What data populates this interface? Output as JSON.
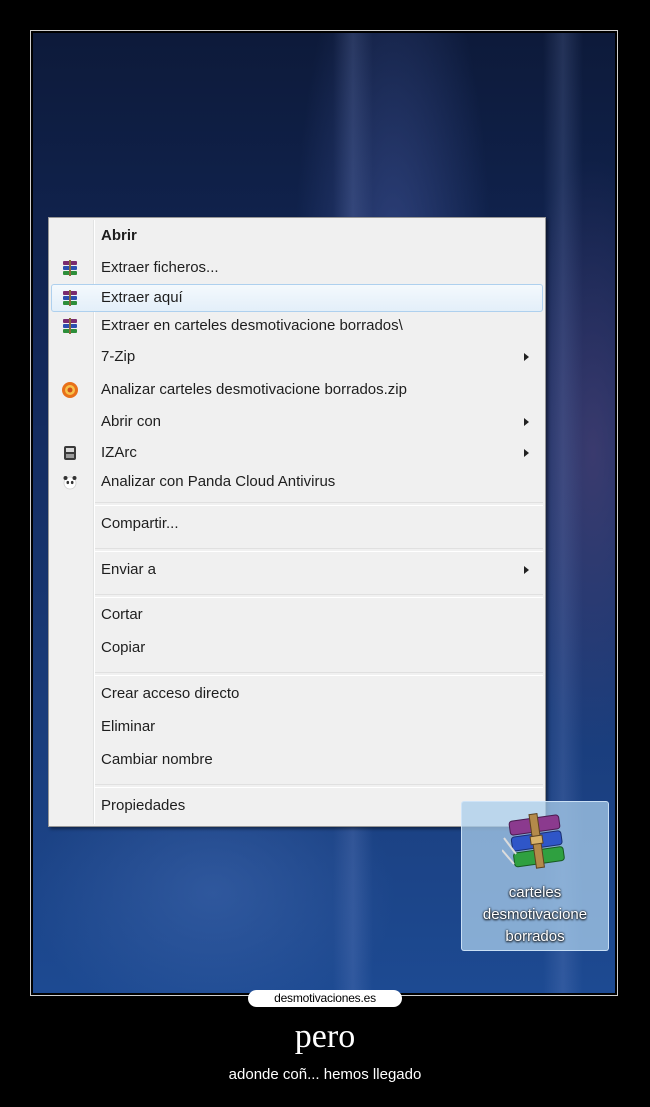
{
  "menu": {
    "items": [
      {
        "label": "Abrir",
        "bold": true,
        "icon": "",
        "submenu": false,
        "hover": false
      },
      {
        "label": "Extraer ficheros...",
        "icon": "winrar-icon",
        "submenu": false,
        "hover": false
      },
      {
        "label": "Extraer aquí",
        "icon": "winrar-icon",
        "submenu": false,
        "hover": true
      },
      {
        "label": "Extraer en carteles desmotivacione borrados\\",
        "icon": "winrar-icon",
        "submenu": false,
        "hover": false
      },
      {
        "label": "7-Zip",
        "icon": "",
        "submenu": true,
        "hover": false
      },
      {
        "label": "Analizar carteles desmotivacione borrados.zip",
        "icon": "antivirus-scan-icon",
        "submenu": false,
        "hover": false
      },
      {
        "label": "Abrir con",
        "icon": "",
        "submenu": true,
        "hover": false
      },
      {
        "label": "IZArc",
        "icon": "izarc-icon",
        "submenu": true,
        "hover": false
      },
      {
        "label": "Analizar con Panda Cloud Antivirus",
        "icon": "panda-icon",
        "submenu": false,
        "hover": false
      },
      {
        "label": "Compartir...",
        "icon": "",
        "submenu": false,
        "hover": false
      },
      {
        "label": "Enviar a",
        "icon": "",
        "submenu": true,
        "hover": false
      },
      {
        "label": "Cortar",
        "icon": "",
        "submenu": false,
        "hover": false
      },
      {
        "label": "Copiar",
        "icon": "",
        "submenu": false,
        "hover": false
      },
      {
        "label": "Crear acceso directo",
        "icon": "",
        "submenu": false,
        "hover": false
      },
      {
        "label": "Eliminar",
        "icon": "",
        "submenu": false,
        "hover": false
      },
      {
        "label": "Cambiar nombre",
        "icon": "",
        "submenu": false,
        "hover": false
      },
      {
        "label": "Propiedades",
        "icon": "",
        "submenu": false,
        "hover": false
      }
    ]
  },
  "desktop_file": {
    "icon": "winrar-archive-icon",
    "label_lines": [
      "carteles",
      "desmotivacione",
      "borrados"
    ]
  },
  "footer": {
    "brand": "desmotivaciones.es",
    "title": "pero",
    "subtitle": "adonde coñ... hemos llegado"
  },
  "colors": {
    "menu_bg": "#f0f0f0",
    "hover_border": "#aed0ee",
    "selection_bg": "#aacdeb"
  }
}
